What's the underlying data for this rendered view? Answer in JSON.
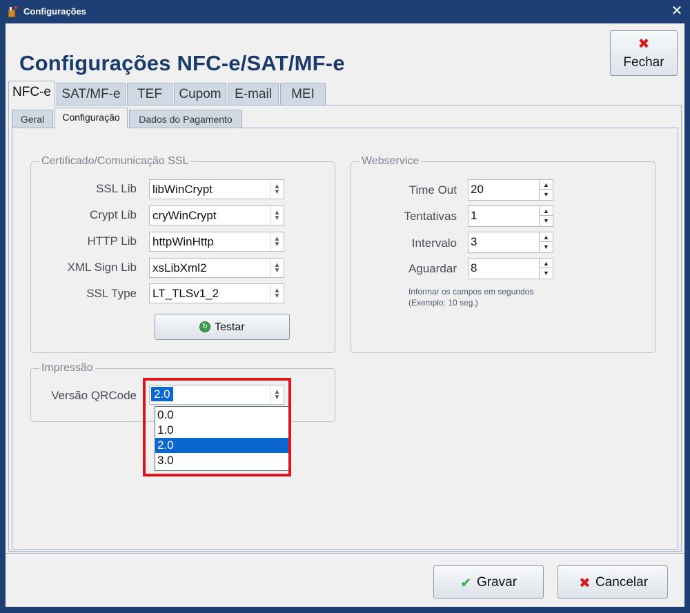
{
  "window": {
    "title": "Configurações",
    "close_glyph": "✕"
  },
  "header": {
    "title": "Configurações NFC-e/SAT/MF-e",
    "fechar_label": "Fechar",
    "fechar_icon": "✖"
  },
  "main_tabs": [
    {
      "label": "NFC-e",
      "active": true
    },
    {
      "label": "SAT/MF-e"
    },
    {
      "label": "TEF"
    },
    {
      "label": "Cupom"
    },
    {
      "label": "E-mail"
    },
    {
      "label": "MEI"
    }
  ],
  "sub_tabs": [
    {
      "label": "Geral"
    },
    {
      "label": "Configuração",
      "active": true
    },
    {
      "label": "Dados do Pagamento"
    }
  ],
  "cert_group": {
    "title": "Certificado/Comunicação SSL",
    "fields": [
      {
        "label": "SSL Lib",
        "value": "libWinCrypt"
      },
      {
        "label": "Crypt Lib",
        "value": "cryWinCrypt"
      },
      {
        "label": "HTTP Lib",
        "value": "httpWinHttp"
      },
      {
        "label": "XML Sign Lib",
        "value": "xsLibXml2"
      },
      {
        "label": "SSL Type",
        "value": "LT_TLSv1_2"
      }
    ],
    "testar_label": "Testar"
  },
  "webservice_group": {
    "title": "Webservice",
    "fields": [
      {
        "label": "Time Out",
        "value": "20"
      },
      {
        "label": "Tentativas",
        "value": "1"
      },
      {
        "label": "Intervalo",
        "value": "3"
      },
      {
        "label": "Aguardar",
        "value": "8"
      }
    ],
    "note_line1": "Informar os campos em segundos",
    "note_line2": "(Exemplo: 10 seg.)"
  },
  "impressao_group": {
    "title": "Impressão",
    "qrcode_label": "Versão QRCode",
    "qrcode_value": "2.0",
    "qrcode_options": [
      "0.0",
      "1.0",
      "2.0",
      "3.0"
    ],
    "qrcode_selected_index": 2
  },
  "footer": {
    "gravar_label": "Gravar",
    "gravar_icon": "✔",
    "cancelar_label": "Cancelar",
    "cancelar_icon": "✖"
  },
  "colors": {
    "title_bar": "#1d3f73",
    "heading": "#1a3b6e",
    "selection": "#0a67d2",
    "highlight_box": "#e1131c",
    "ok_green": "#3fae49",
    "cancel_red": "#d21c1c"
  }
}
